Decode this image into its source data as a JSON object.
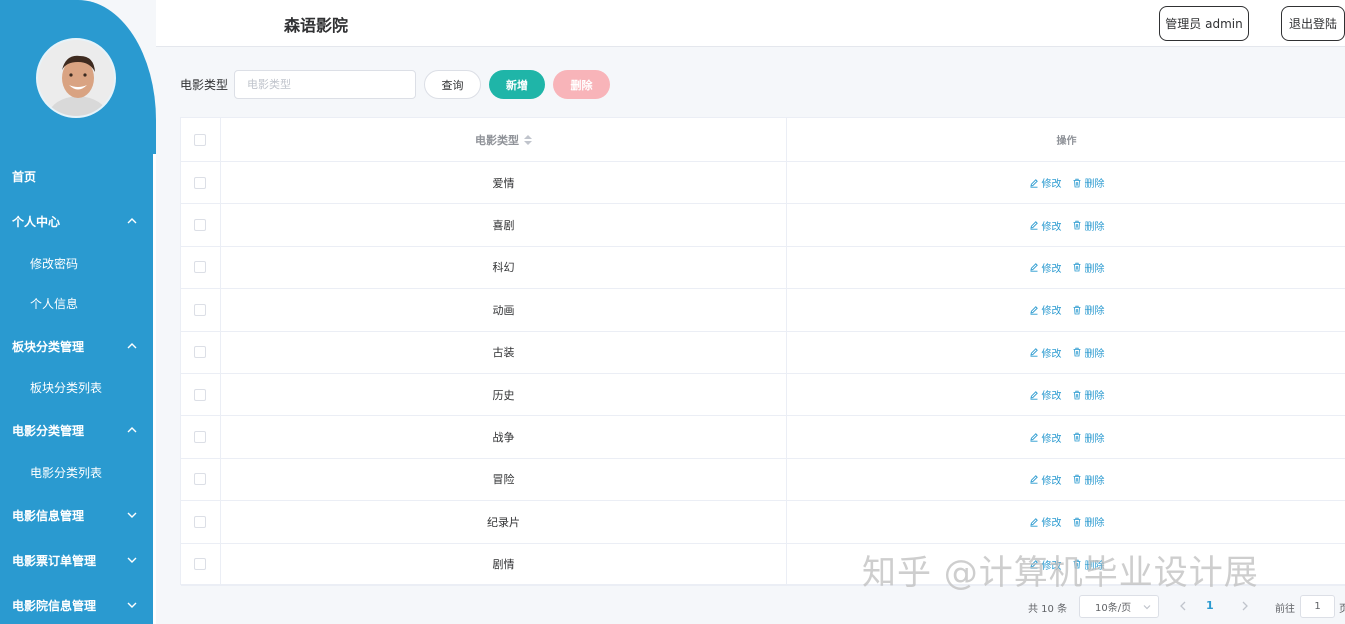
{
  "app": {
    "title": "森语影院"
  },
  "header": {
    "user_label": "管理员 admin",
    "logout_label": "退出登陆"
  },
  "sidebar": {
    "items": [
      {
        "label": "首页",
        "level": 0,
        "chevron": "none"
      },
      {
        "label": "个人中心",
        "level": 0,
        "chevron": "up"
      },
      {
        "label": "修改密码",
        "level": 1,
        "chevron": "none"
      },
      {
        "label": "个人信息",
        "level": 1,
        "chevron": "none"
      },
      {
        "label": "板块分类管理",
        "level": 0,
        "chevron": "up"
      },
      {
        "label": "板块分类列表",
        "level": 1,
        "chevron": "none"
      },
      {
        "label": "电影分类管理",
        "level": 0,
        "chevron": "up"
      },
      {
        "label": "电影分类列表",
        "level": 1,
        "chevron": "none"
      },
      {
        "label": "电影信息管理",
        "level": 0,
        "chevron": "down"
      },
      {
        "label": "电影票订单管理",
        "level": 0,
        "chevron": "down"
      },
      {
        "label": "电影院信息管理",
        "level": 0,
        "chevron": "down"
      }
    ]
  },
  "search": {
    "label": "电影类型",
    "placeholder": "电影类型",
    "query_label": "查询",
    "add_label": "新增",
    "delete_label": "删除"
  },
  "table": {
    "columns": [
      "电影类型",
      "操作"
    ],
    "edit_label": "修改",
    "delete_label": "删除",
    "rows": [
      "爱情",
      "喜剧",
      "科幻",
      "动画",
      "古装",
      "历史",
      "战争",
      "冒险",
      "纪录片",
      "剧情"
    ]
  },
  "pagination": {
    "total_text": "共 10 条",
    "page_size": "10条/页",
    "current_page": "1",
    "goto_label": "前往",
    "goto_value": "1",
    "page_suffix": "页"
  },
  "watermark": "知乎 @计算机毕业设计展",
  "colors": {
    "sidebar": "#2a9ad0",
    "add": "#1fb5a8",
    "delete": "#f8b4b9",
    "link": "#2a9ad0"
  },
  "icons": {
    "edit": "edit-icon",
    "delete": "trash-icon",
    "sort": "sort-icon"
  }
}
